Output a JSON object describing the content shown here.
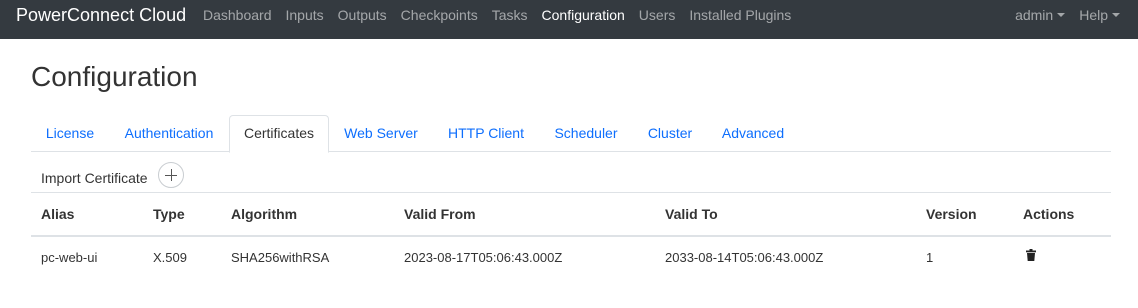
{
  "navbar": {
    "brand": "PowerConnect Cloud",
    "items": [
      {
        "label": "Dashboard"
      },
      {
        "label": "Inputs"
      },
      {
        "label": "Outputs"
      },
      {
        "label": "Checkpoints"
      },
      {
        "label": "Tasks"
      },
      {
        "label": "Configuration",
        "active": true
      },
      {
        "label": "Users"
      },
      {
        "label": "Installed Plugins"
      }
    ],
    "user_menu": "admin",
    "help_menu": "Help"
  },
  "page": {
    "title": "Configuration"
  },
  "tabs": [
    {
      "label": "License"
    },
    {
      "label": "Authentication"
    },
    {
      "label": "Certificates",
      "active": true
    },
    {
      "label": "Web Server"
    },
    {
      "label": "HTTP Client"
    },
    {
      "label": "Scheduler"
    },
    {
      "label": "Cluster"
    },
    {
      "label": "Advanced"
    }
  ],
  "certificates": {
    "import_label": "Import Certificate",
    "import_icon": "plus-icon",
    "columns": [
      "Alias",
      "Type",
      "Algorithm",
      "Valid From",
      "Valid To",
      "Version",
      "Actions"
    ],
    "rows": [
      {
        "alias": "pc-web-ui",
        "type": "X.509",
        "algorithm": "SHA256withRSA",
        "valid_from": "2023-08-17T05:06:43.000Z",
        "valid_to": "2033-08-14T05:06:43.000Z",
        "version": "1",
        "action_icon": "trash-icon"
      }
    ]
  },
  "colors": {
    "navbar_bg": "#343a40",
    "link": "#0d6efd",
    "text": "#333333",
    "border": "#dee2e6"
  }
}
